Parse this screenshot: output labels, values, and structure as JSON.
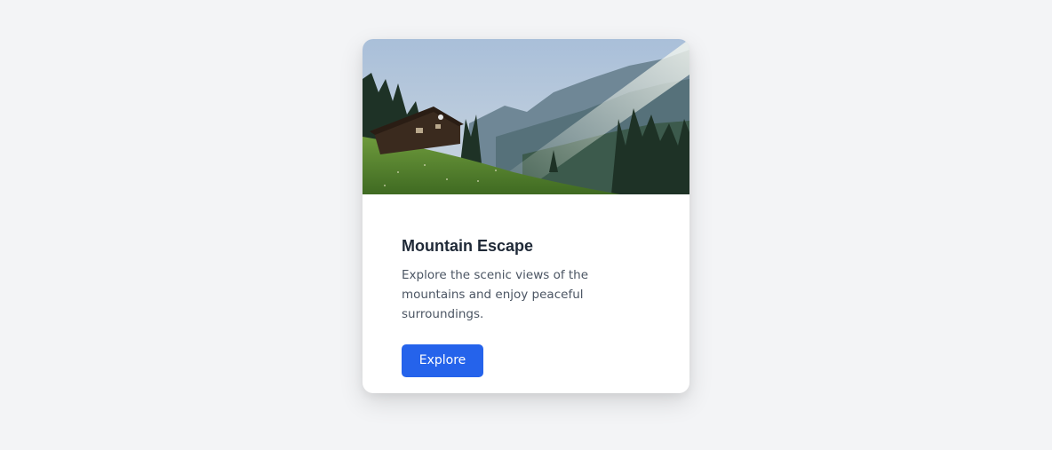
{
  "card": {
    "image_alt": "Wooden cabin on a grassy hillside with misty mountains and pine trees",
    "title": "Mountain Escape",
    "description": "Explore the scenic views of the mountains and enjoy peaceful surroundings.",
    "button_label": "Explore"
  },
  "colors": {
    "page_background": "#f3f4f6",
    "card_background": "#ffffff",
    "title": "#1f2937",
    "description": "#4b5563",
    "button_background": "#2563eb",
    "button_text": "#ffffff"
  }
}
